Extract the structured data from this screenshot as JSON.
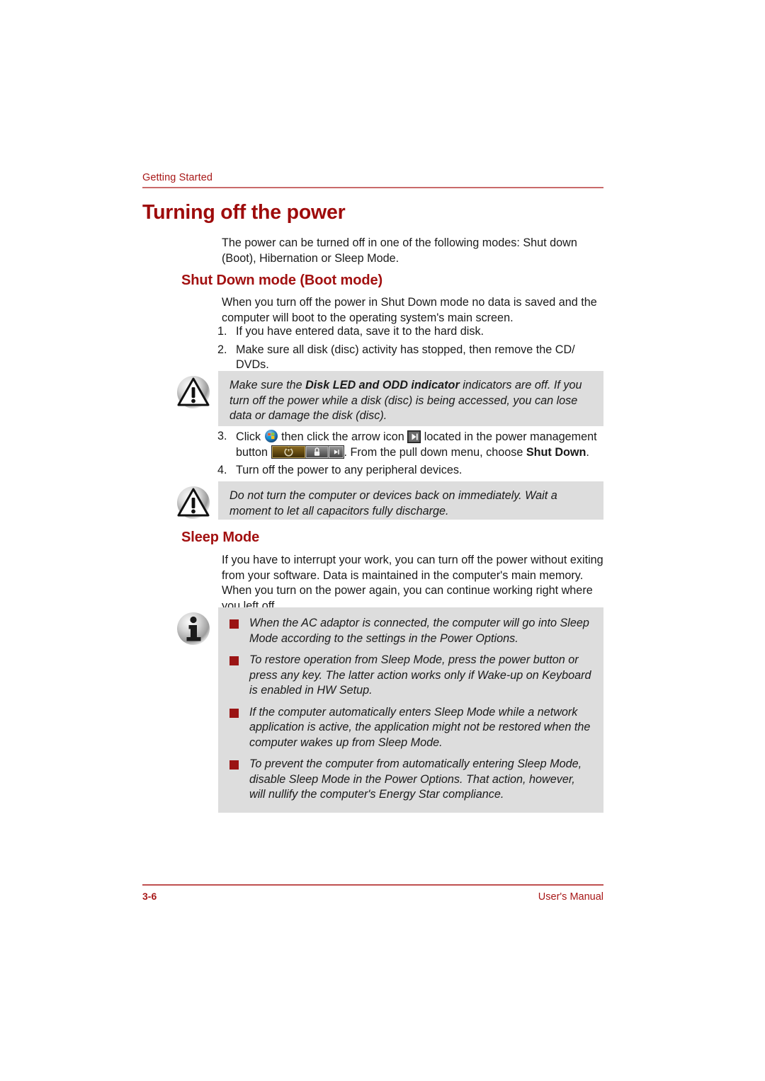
{
  "header": {
    "section_label": "Getting Started"
  },
  "title": "Turning off the power",
  "sections": {
    "shutdown": {
      "heading": "Shut Down mode (Boot mode)",
      "intro": "The power can be turned off in one of the following modes: Shut down (Boot), Hibernation or Sleep Mode.",
      "paragraph": "When you turn off the power in Shut Down mode no data is saved and the computer will boot to the operating system's main screen.",
      "steps_a": [
        {
          "num": "1.",
          "text": "If you have entered data, save it to the hard disk."
        },
        {
          "num": "2.",
          "text": "Make sure all disk (disc) activity has stopped, then remove the CD/ DVDs."
        }
      ],
      "steps_b": [
        {
          "num": "3.",
          "text_parts": {
            "p1": "Click ",
            "p2": " then click the arrow icon ",
            "p3": " located in the power management button ",
            "p4": ". From the pull down menu, choose ",
            "p5": "Shut Down",
            "p6": "."
          }
        },
        {
          "num": "4.",
          "text": "Turn off the power to any peripheral devices."
        }
      ]
    },
    "sleep": {
      "heading": "Sleep Mode",
      "paragraph": "If you have to interrupt your work, you can turn off the power without exiting from your software. Data is maintained in the computer's main memory. When you turn on the power again, you can continue working right where you left off."
    }
  },
  "notes": [
    {
      "icon": "warning-triangle-icon",
      "text_parts": {
        "p1": "Make sure the ",
        "p2": "Disk LED and ODD indicator",
        "p3": " indicators are off. If you turn off the power while a disk (disc) is being accessed, you can lose data or damage the disk (disc)."
      }
    },
    {
      "icon": "warning-triangle-icon",
      "text": "Do not turn the computer or devices back on immediately. Wait a moment to let all capacitors fully discharge."
    }
  ],
  "info_note": {
    "icon": "info-circle-icon",
    "bullets": [
      "When the AC adaptor is connected, the computer will go into Sleep Mode according to the settings in the Power Options.",
      "To restore operation from Sleep Mode, press the power button or press any key. The latter action works only if Wake-up on Keyboard is enabled in HW Setup.",
      "If the computer automatically enters Sleep Mode while a network application is active, the application might not be restored when the computer wakes up from Sleep Mode.",
      "To prevent the computer from automatically entering Sleep Mode, disable Sleep Mode in the Power Options. That action, however, will nullify the computer's Energy Star compliance."
    ]
  },
  "inline_icons": {
    "start_orb": "windows-start-orb-icon",
    "arrow": "arrow-right-icon",
    "power_button_strip": "power-management-button-icon"
  },
  "footer": {
    "page_number": "3-6",
    "manual_label": "User's Manual"
  },
  "colors": {
    "accent_red": "#9E0B0B",
    "header_red": "#A81818",
    "rule_rose": "#C96A6A",
    "note_gray": "#DDDDDD",
    "bullet_red": "#9B1414"
  }
}
